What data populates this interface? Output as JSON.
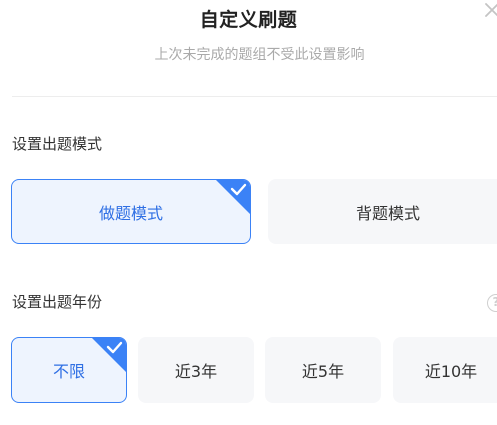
{
  "dialog": {
    "title": "自定义刷题",
    "subtitle": "上次未完成的题组不受此设置影响"
  },
  "mode_section": {
    "label": "设置出题模式",
    "options": [
      {
        "label": "做题模式",
        "selected": true
      },
      {
        "label": "背题模式",
        "selected": false
      }
    ]
  },
  "year_section": {
    "label": "设置出题年份",
    "help_icon": "?",
    "options": [
      {
        "label": "不限",
        "selected": true
      },
      {
        "label": "近3年",
        "selected": false
      },
      {
        "label": "近5年",
        "selected": false
      },
      {
        "label": "近10年",
        "selected": false
      }
    ]
  },
  "colors": {
    "accent": "#3b82f6",
    "selected_bg": "#eef4fe",
    "option_bg": "#f6f7f9"
  }
}
